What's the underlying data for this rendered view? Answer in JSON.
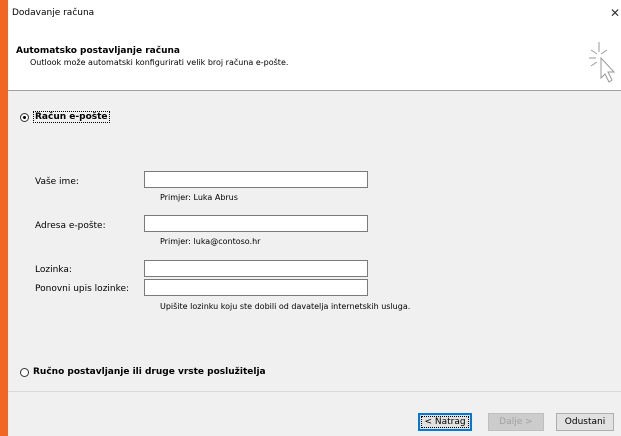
{
  "window": {
    "title": "Dodavanje računa"
  },
  "header": {
    "title": "Automatsko postavljanje računa",
    "subtitle": "Outlook može automatski konfigurirati velik broj računa e-pošte."
  },
  "options": {
    "email_account": "Račun e-pošte",
    "manual_setup": "Ručno postavljanje ili druge vrste poslužitelja"
  },
  "form": {
    "name_label": "Vaše ime:",
    "name_value": "",
    "name_hint": "Primjer: Luka Abrus",
    "email_label": "Adresa e-pošte:",
    "email_value": "",
    "email_hint": "Primjer: luka@contoso.hr",
    "password_label": "Lozinka:",
    "password_value": "",
    "retype_label": "Ponovni upis lozinke:",
    "retype_value": "",
    "password_hint": "Upišite lozinku koju ste dobili od davatelja internetskih usluga."
  },
  "buttons": {
    "back": "< Natrag",
    "next": "Dalje >",
    "cancel": "Odustani"
  },
  "colors": {
    "accent": "#0078d7",
    "background_border": "#f26522"
  }
}
